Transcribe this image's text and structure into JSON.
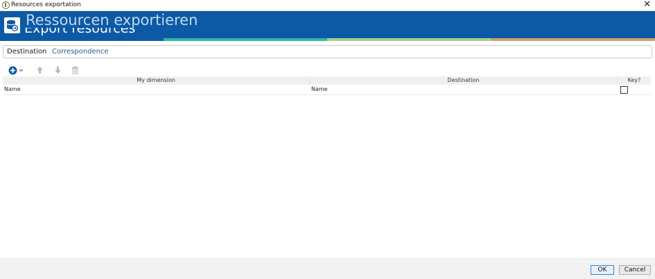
{
  "window": {
    "title": "Resources exportation",
    "close_glyph": "✕"
  },
  "banner": {
    "title": "Ressourcen exportieren",
    "ghost_title": "Export resources",
    "icon": "database-export-icon",
    "colors": {
      "background": "#0c5aa6",
      "stripe": [
        "#0c5aa6",
        "#2fb7a0",
        "#a6d08a",
        "#c9a06a"
      ]
    }
  },
  "tabs": [
    {
      "label": "Destination",
      "active": false
    },
    {
      "label": "Correspondence",
      "active": true
    }
  ],
  "toolbar": {
    "icons": [
      "add-icon",
      "chevron-down-icon",
      "move-up-icon",
      "move-down-icon",
      "delete-icon"
    ],
    "add_dropdown_glyph": "⌄"
  },
  "grid": {
    "columns": [
      "My dimension",
      "Destination",
      "Key?"
    ],
    "rows": [
      {
        "my_dimension": "Name",
        "destination": "Name",
        "key": false
      }
    ]
  },
  "footer": {
    "ok_label": "OK",
    "cancel_label": "Cancel"
  }
}
